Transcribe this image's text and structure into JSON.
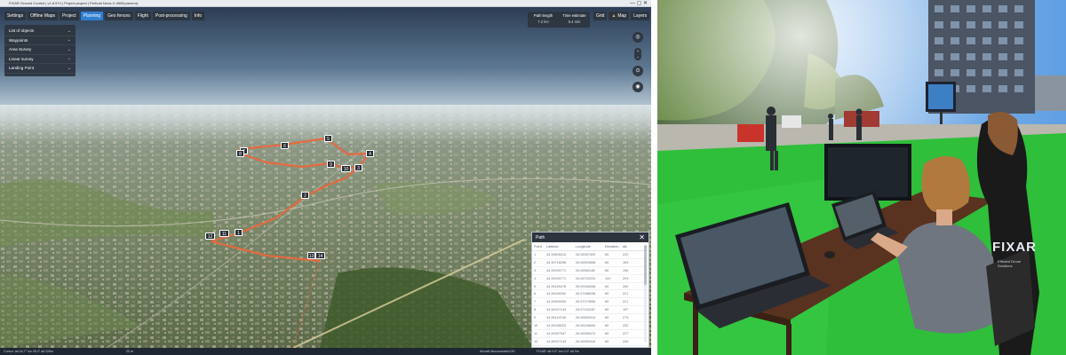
{
  "window": {
    "title": "FIXAR Ground Control | v1.6.574 | Project project | Perhost Nova-X-4800(camera)",
    "controls": "— ▢ ✕"
  },
  "menu": [
    "Settings",
    "Offline Maps",
    "Project",
    "Planning",
    "Geo fences",
    "Flight",
    "Post-processing",
    "Info"
  ],
  "menu_active": "Planning",
  "objects_panel": [
    "List of objects",
    "Waypoints",
    "Area Survey",
    "Linear survey",
    "Landing Point"
  ],
  "path_info": {
    "length_label": "Path length",
    "length_value": "7.2 km",
    "time_label": "Time estimate",
    "time_value": "8.4 min"
  },
  "top_right": {
    "grid": "Grid",
    "map": "Map",
    "layers": "Layers"
  },
  "side_tools": [
    "compass-icon",
    "zoom-in-icon",
    "zoom-out-icon",
    "recenter-icon",
    "camera-icon"
  ],
  "waypoints": [
    "1",
    "2",
    "3",
    "4",
    "5",
    "6",
    "7",
    "8",
    "9",
    "10",
    "11",
    "12",
    "13",
    "14"
  ],
  "path_table": {
    "title": "Path",
    "close": "✕",
    "columns": [
      "Point",
      "Latitude",
      "Longitude",
      "Elevation",
      "Alt."
    ],
    "rows": [
      [
        "1",
        "44.39826010",
        "26.06957529",
        "80",
        "220"
      ],
      [
        "2",
        "44.39718298",
        "26.06593898",
        "80",
        "183"
      ],
      [
        "3",
        "44.39259771",
        "26.06562182",
        "80",
        "196"
      ],
      [
        "4",
        "44.39259771",
        "26.06700224",
        "100",
        "203"
      ],
      [
        "5",
        "44.39189478",
        "26.05166008",
        "80",
        "260"
      ],
      [
        "6",
        "44.39439292",
        "26.07488038",
        "80",
        "221"
      ],
      [
        "7",
        "44.39509053",
        "26.07079595",
        "80",
        "221"
      ],
      [
        "8",
        "44.39027143",
        "26.07152287",
        "80",
        "197"
      ],
      [
        "9",
        "44.39119748",
        "26.06552914",
        "80",
        "273"
      ],
      [
        "10",
        "44.39038223",
        "26.06246694",
        "80",
        "222"
      ],
      [
        "11",
        "44.39307547",
        "26.06955474",
        "80",
        "227"
      ],
      [
        "12",
        "44.39027143",
        "26.06950416",
        "80",
        "206"
      ]
    ]
  },
  "statusbar": {
    "cursor": "Cursor: lat 44.7°   lon 26.4°   alt 226m",
    "scale": "20 m",
    "conn": "Aircraft disconnected 0/0",
    "fixar": "FIXAR: lat 0.0°   lon 0.0°   alt 0m"
  },
  "photo": {
    "shirt_brand": "FIXAR",
    "shirt_tagline": "Efficient Drone Solutions"
  },
  "colors": {
    "accent": "#2f7fd1",
    "panel": "#2d343e",
    "path": "#e9683d",
    "grass": "#2fbf3a"
  }
}
